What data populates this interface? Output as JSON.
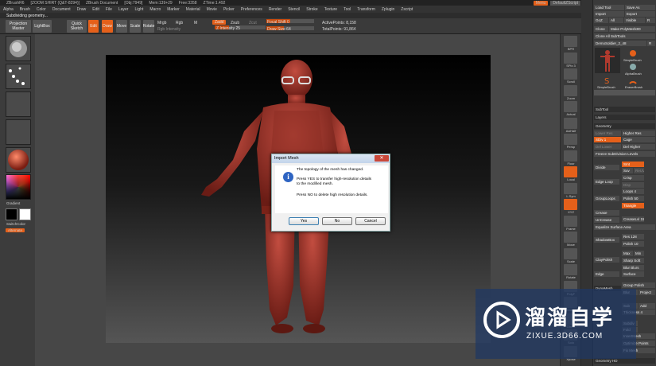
{
  "titlebar": {
    "app": "ZBrushR6",
    "info": "[ZOOM SHIRT (Q&T-8294)]",
    "doc": "ZBrush Document",
    "obj": "[Obj:7949]",
    "mem": "Mem:139+29",
    "free": "Free:3358",
    "ztime": "ZTime:1.492",
    "menu_btn": "Menu",
    "script_btn": "DefaultZScript"
  },
  "menubar": {
    "items": [
      "Alpha",
      "Brush",
      "Color",
      "Document",
      "Draw",
      "Edit",
      "File",
      "Layer",
      "Light",
      "Macro",
      "Marker",
      "Material",
      "Movie",
      "Picker",
      "Preferences",
      "Render",
      "Stencil",
      "Stroke",
      "Texture",
      "Tool",
      "Transform",
      "Zplugin",
      "Zscript"
    ]
  },
  "subbar": {
    "status": "Subdividing geometry..."
  },
  "toolbar": {
    "projection_master": "Projection Master",
    "lightbox": "LightBox",
    "quick_sketch": "Quick Sketch",
    "edit": "Edit",
    "draw": "Draw",
    "move": "Move",
    "scale": "Scale",
    "rotate": "Rotate",
    "mrgb": "Mrgb",
    "rgb": "Rgb",
    "m": "M",
    "rgb_intensity": "Rgb Intensity",
    "zadd": "Zadd",
    "zsub": "Zsub",
    "zcut": "Zcut",
    "z_intensity": "Z Intensity 25",
    "focal_shift": "Focal Shift 0",
    "draw_size": "Draw Size 64",
    "active_points": "ActivePoints: 8,158",
    "total_points": "TotalPoints: 91,864"
  },
  "leftpanel": {
    "gradient": "Gradient",
    "switchcolor": "SwitchColor",
    "alternate": "Alternate"
  },
  "righttray": {
    "items": [
      "BPR",
      "SPix 3",
      "Scroll",
      "Zoom",
      "Actual",
      "AAHalf",
      "Persp",
      "Floor",
      "Local",
      "L.Sym",
      "XYZ",
      "Frame",
      "Move",
      "Scale",
      "Rotate",
      "PolyF",
      "Transp",
      "Ghost",
      "Solo",
      "Xpose"
    ]
  },
  "palette": {
    "load_tool": "Load Tool",
    "save_as": "Save As",
    "import": "Import",
    "export": "Export",
    "goz": "GoZ",
    "all": "All",
    "visible": "Visible",
    "r": "R",
    "clone": "Clone",
    "make_polymesh": "Make PolyMesh3D",
    "clone_all": "Clone All SubTools",
    "tool_name": "DemoSoldier_2_48",
    "r2": "R",
    "simplebrush": "SimpleBrush",
    "alphabrush": "AlphaBrush",
    "simplebrush2": "SimpleBrush",
    "eraserbrush": "EraserBrush",
    "subtool": "SubTool",
    "layers": "Layers",
    "geometry": "Geometry",
    "lower_res": "Lower Res",
    "higher_res": "Higher Res",
    "sdiv": "SDiv 1",
    "cage": "Cage",
    "rstr": "Rstr",
    "del_lower": "Del Lower",
    "del_higher": "Del Higher",
    "freeze_subdiv": "Freeze SubDivision Levels",
    "divide": "Divide",
    "smt": "Smt",
    "suv": "Suv",
    "reuv": "ReUV",
    "edge_loop": "Edge Loop",
    "crisp": "Crisp",
    "disp": "Disp",
    "loops": "Loops 4",
    "grouploops": "GroupLoops",
    "polish": "Polish 50",
    "triangle": "Triangle",
    "crease": "Crease",
    "crease_lvl": "CreaseLvl 15",
    "uncrease": "UnCrease",
    "equalize": "Equalize Surface Area",
    "shadowbox": "ShadowBox",
    "res": "Res 128",
    "polish2": "Polish 10",
    "claypolish": "ClayPolish",
    "max": "Max",
    "min": "Min",
    "sharp_soft": "Sharp Soft",
    "blur_blurs": "Blur Blurs",
    "edge": "Edge",
    "surface": "Surface",
    "dynamesh": "DynaMesh",
    "group_polish": "Group Polish",
    "blur": "Blur",
    "project": "Project",
    "sub": "Sub",
    "add": "Add",
    "thickness": "Thickness 4",
    "subdiv": "Subdiv",
    "fold": "Fold",
    "insertmesh": "InsertMesh",
    "optimize": "Optimize Points",
    "fix_mesh": "Fix Mesh",
    "geometry_hd": "Geometry HD"
  },
  "dialog": {
    "title": "Import Mesh",
    "line1": "The topology of the mesh has changed.",
    "line2a": "Press YES to transfer high-resolution details",
    "line2b": "to the modified mesh.",
    "line3": "Press NO to delete high resolution details.",
    "yes": "Yes",
    "no": "No",
    "cancel": "Cancel",
    "close_glyph": "✕",
    "info_glyph": "i"
  },
  "watermark": {
    "brand": "溜溜自学",
    "url": "ZIXUE.3D66.COM"
  },
  "colors": {
    "accent": "#e5601a",
    "skin": "#a8382e"
  }
}
